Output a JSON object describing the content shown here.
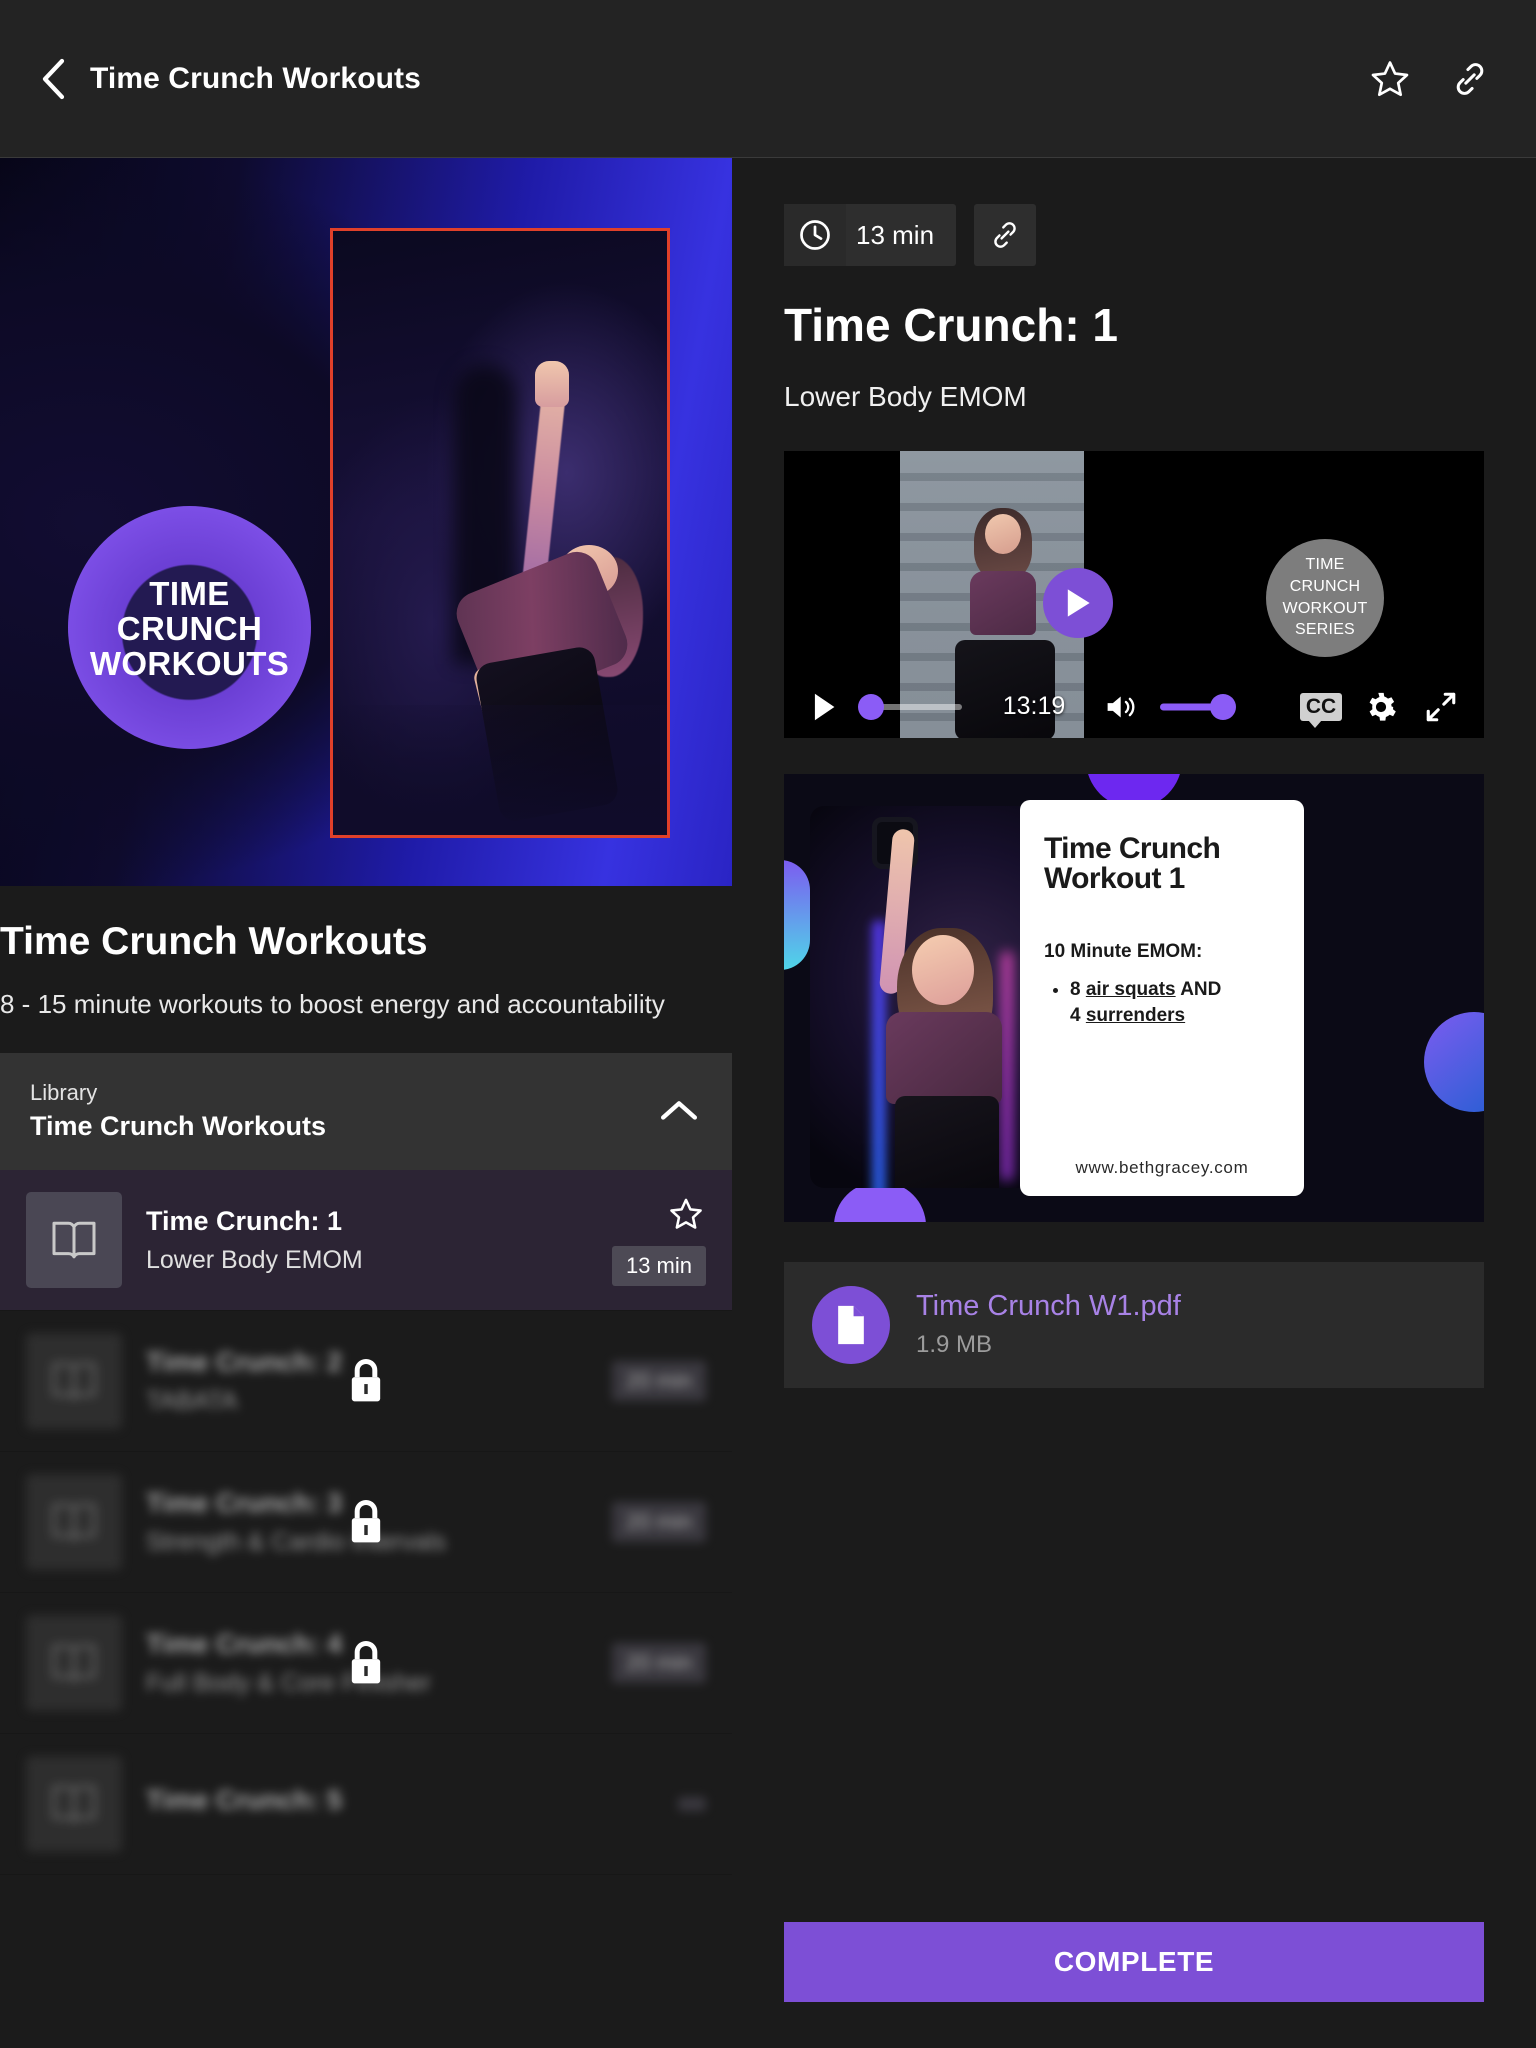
{
  "topbar": {
    "back_icon": "chevron-left-icon",
    "title": "Time Crunch Workouts",
    "favorite_icon": "star-outline-icon",
    "share_icon": "link-icon"
  },
  "hero": {
    "badge_text": "TIME\nCRUNCH\nWORKOUTS"
  },
  "course": {
    "title": "Time Crunch Workouts",
    "description": "8 - 15 minute workouts to boost energy and accountability"
  },
  "section": {
    "kicker": "Library",
    "name": "Time Crunch Workouts",
    "collapse_icon": "chevron-up-icon"
  },
  "lessons": [
    {
      "title": "Time Crunch: 1",
      "subtitle": "Lower Body EMOM",
      "duration": "13 min",
      "locked": false,
      "active": true,
      "thumb_icon": "book-icon",
      "star_icon": "star-outline-icon"
    },
    {
      "title": "Time Crunch: 2",
      "subtitle": "TABATA",
      "duration": "20 min",
      "locked": true,
      "active": false,
      "thumb_icon": "book-icon",
      "lock_icon": "lock-icon"
    },
    {
      "title": "Time Crunch: 3",
      "subtitle": "Strength & Cardio Intervals",
      "duration": "20 min",
      "locked": true,
      "active": false,
      "thumb_icon": "book-icon",
      "lock_icon": "lock-icon"
    },
    {
      "title": "Time Crunch: 4",
      "subtitle": "Full Body & Core Finisher",
      "duration": "20 min",
      "locked": true,
      "active": false,
      "thumb_icon": "book-icon",
      "lock_icon": "lock-icon"
    },
    {
      "title": "Time Crunch: 5",
      "subtitle": "",
      "duration": "",
      "locked": true,
      "active": false,
      "thumb_icon": "book-icon",
      "lock_icon": "lock-icon"
    }
  ],
  "detail": {
    "duration_chip": "13 min",
    "duration_icon": "clock-icon",
    "share_icon": "link-icon",
    "title": "Time Crunch: 1",
    "subtitle": "Lower Body EMOM"
  },
  "video": {
    "badge_text": "TIME\nCRUNCH\nWORKOUT\nSERIES",
    "big_play_icon": "play-circle-icon",
    "play_icon": "play-icon",
    "time": "13:19",
    "volume_icon": "volume-high-icon",
    "cc_label": "CC",
    "settings_icon": "gear-icon",
    "fullscreen_icon": "expand-icon",
    "seek_progress_pct": 0,
    "volume_pct": 100
  },
  "workout_card": {
    "title": "Time Crunch\nWorkout 1",
    "heading": "10 Minute EMOM:",
    "items": [
      "8 air squats AND 4 surrenders"
    ],
    "item_1_a": "8 ",
    "item_1_b": "air squats",
    "item_1_c": " AND",
    "item_2_a": "4 ",
    "item_2_b": "surrenders",
    "url": "www.bethgracey.com"
  },
  "attachment": {
    "name": "Time Crunch W1.pdf",
    "size": "1.9 MB",
    "icon": "file-document-icon"
  },
  "complete_button": {
    "label": "COMPLETE"
  },
  "colors": {
    "accent_purple": "#7d4fd6",
    "link_purple": "#a882e6",
    "page_bg": "#1b1b1b",
    "topbar_bg": "#232323",
    "panel_bg": "#2b2b2b",
    "active_row_bg": "#2c2434"
  }
}
